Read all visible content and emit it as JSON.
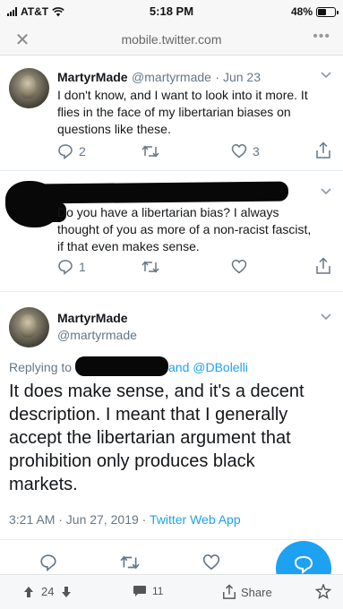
{
  "status_bar": {
    "carrier": "AT&T",
    "time": "5:18 PM",
    "battery": "48%",
    "battery_level": 0.48
  },
  "browser": {
    "url": "mobile.twitter.com",
    "close_icon": "close-icon",
    "more_icon": "more-dots-icon"
  },
  "tweet1": {
    "name": "MartyrMade",
    "handle": "@martyrmade",
    "date": "· Jun 23",
    "text_lines": [
      "I don't know, and I want to look into it more. It",
      "flies in the face of my libertarian biases on",
      "questions like these."
    ],
    "replies": "2",
    "likes": "3"
  },
  "tweet2": {
    "text_lines": [
      "Do you have a libertarian bias? I always",
      "thought of you as more of a non-racist fascist,",
      "if that even makes sense."
    ],
    "replies": "1"
  },
  "tweet3": {
    "name": "MartyrMade",
    "handle": "@martyrmade",
    "replying_prefix": "Replying to",
    "replying_suffix": "and @DBolelli",
    "text_lines": [
      "It does make sense, and it's a decent",
      "description. I meant that I generally",
      "accept the libertarian argument that",
      "prohibition only produces black",
      "markets."
    ],
    "timestamp": "3:21 AM · Jun 27, 2019 · ",
    "source": "Twitter Web App"
  },
  "bottom_bar": {
    "votes": "24",
    "comments": "11",
    "share_label": "Share"
  },
  "colors": {
    "accent": "#1da1f2",
    "muted": "#657786",
    "text": "#14171a"
  }
}
